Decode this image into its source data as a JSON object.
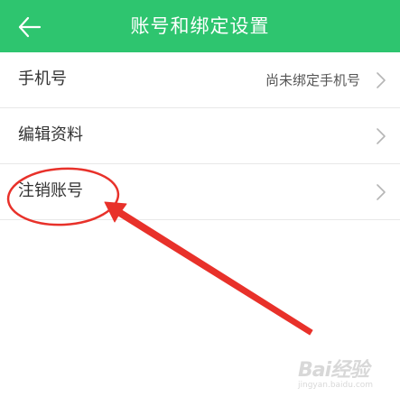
{
  "header": {
    "title": "账号和绑定设置",
    "back_icon": "back-arrow-icon",
    "background_color": "#2ec56f"
  },
  "settings": {
    "items": [
      {
        "label": "手机号",
        "value": "尚未绑定手机号",
        "icon": "chevron-right-icon"
      },
      {
        "label": "编辑资料",
        "icon": "chevron-right-icon"
      },
      {
        "label": "注销账号",
        "icon": "chevron-right-icon"
      }
    ]
  },
  "annotation": {
    "color": "#e8312a",
    "shapes": [
      "ellipse",
      "arrow"
    ]
  },
  "watermark": {
    "brand": "Bai经验",
    "site": "jingyan.baidu.com"
  }
}
